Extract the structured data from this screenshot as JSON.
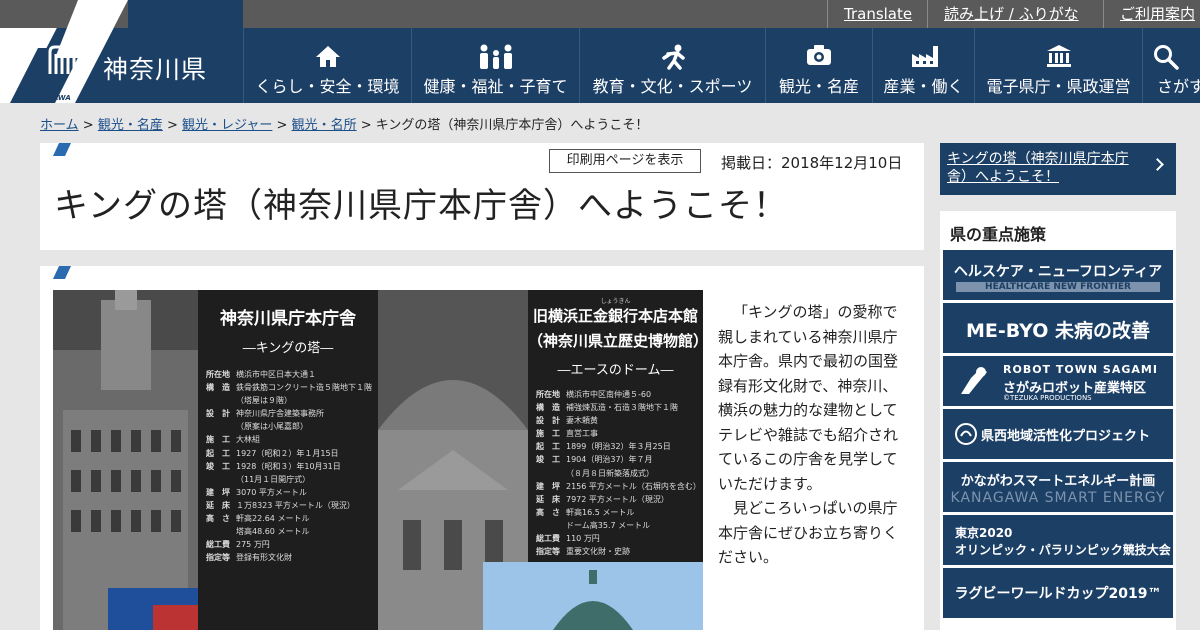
{
  "topbar": {
    "translate": "Translate",
    "read_aloud": "読み上げ / ふりがな",
    "guide": "ご利用案内"
  },
  "header": {
    "prefecture": "神奈川県",
    "logo_sub": "KANAGAWA"
  },
  "nav": [
    {
      "label": "くらし・安全・環境",
      "icon": "house-icon"
    },
    {
      "label": "健康・福祉・子育て",
      "icon": "family-icon"
    },
    {
      "label": "教育・文化・スポーツ",
      "icon": "runner-icon"
    },
    {
      "label": "観光・名産",
      "icon": "camera-icon"
    },
    {
      "label": "産業・働く",
      "icon": "factory-icon"
    },
    {
      "label": "電子県庁・県政運営",
      "icon": "government-building-icon"
    },
    {
      "label": "さがす",
      "icon": "search-icon"
    }
  ],
  "breadcrumb": {
    "home": "ホーム",
    "sep": ">",
    "crumb1": "観光・名産",
    "crumb2": "観光・レジャー",
    "crumb3": "観光・名所",
    "current": "キングの塔（神奈川県庁本庁舎）へようこそ！"
  },
  "article": {
    "print_button": "印刷用ページを表示",
    "published": "掲載日：2018年12月10日",
    "title": "キングの塔（神奈川県庁本庁舎）へようこそ！",
    "paragraph1": "「キングの塔」の愛称で親しまれている神奈川県庁本庁舎。県内で最初の国登録有形文化財で、神奈川、横浜の魅力的な建物としてテレビや雑誌でも紹介されているこの庁舎を見学していただけます。",
    "paragraph2": "見どころいっぱいの県庁本庁舎にぜひお立ち寄りください。"
  },
  "poster": {
    "left_title": "神奈川県庁本庁舎",
    "left_sub": "―キングの塔―",
    "left_specs": [
      {
        "k": "所在地",
        "v": "横浜市中区日本大通１"
      },
      {
        "k": "構　造",
        "v": "鉄骨鉄筋コンクリート造５階地下１階"
      },
      {
        "k": "",
        "v": "（塔屋は９階）"
      },
      {
        "k": "設　計",
        "v": "神奈川県庁舎建築事務所"
      },
      {
        "k": "",
        "v": "（原案は小尾嘉郎）"
      },
      {
        "k": "施　工",
        "v": "大林組"
      },
      {
        "k": "起　工",
        "v": "1927（昭和２）年１月15日"
      },
      {
        "k": "竣　工",
        "v": "1928（昭和３）年10月31日"
      },
      {
        "k": "",
        "v": "（11月１日開庁式）"
      },
      {
        "k": "建　坪",
        "v": "3070 平方メートル"
      },
      {
        "k": "延　床",
        "v": "１万8323 平方メートル（現況）"
      },
      {
        "k": "高　さ",
        "v": "軒高22.64 メートル"
      },
      {
        "k": "",
        "v": "塔高48.60 メートル"
      },
      {
        "k": "総工費",
        "v": "275 万円"
      },
      {
        "k": "指定等",
        "v": "登録有形文化財"
      }
    ],
    "right_ruby": "しょうきん",
    "right_title1": "旧横浜正金銀行本店本館",
    "right_title2": "（神奈川県立歴史博物館）",
    "right_sub": "―エースのドーム―",
    "right_specs": [
      {
        "k": "所在地",
        "v": "横浜市中区南仲通５-60"
      },
      {
        "k": "構　造",
        "v": "補強煉瓦造・石造３階地下１階"
      },
      {
        "k": "設　計",
        "v": "妻木頼黄"
      },
      {
        "k": "施　工",
        "v": "直営工事"
      },
      {
        "k": "起　工",
        "v": "1899（明治32）年３月25日"
      },
      {
        "k": "竣　工",
        "v": "1904（明治37）年７月"
      },
      {
        "k": "",
        "v": "（８月８日新築落成式）"
      },
      {
        "k": "建　坪",
        "v": "2156 平方メートル（石塀内を含む）"
      },
      {
        "k": "延　床",
        "v": "7972 平方メートル（現況）"
      },
      {
        "k": "高　さ",
        "v": "軒高16.5 メートル"
      },
      {
        "k": "",
        "v": "ドーム高35.7 メートル"
      },
      {
        "k": "総工費",
        "v": "110 万円"
      },
      {
        "k": "指定等",
        "v": "重要文化財・史跡"
      }
    ]
  },
  "sidebar": {
    "current_link": "キングの塔（神奈川県庁本庁舎）へようこそ！",
    "heading": "県の重点施策",
    "banners": [
      {
        "main": "ヘルスケア・ニューフロンティア",
        "sub": "HEALTHCARE NEW FRONTIER"
      },
      {
        "main": "ME-BYO  未病の改善",
        "sub": ""
      },
      {
        "main": "ROBOT TOWN SAGAMI",
        "sub": "さがみロボット産業特区",
        "note": "©TEZUKA PRODUCTIONS"
      },
      {
        "main": "県西地域活性化プロジェクト",
        "sub": ""
      },
      {
        "main": "かながわスマートエネルギー計画",
        "sub": "KANAGAWA SMART ENERGY"
      },
      {
        "main": "東京2020",
        "sub": "オリンピック・パラリンピック競技大会"
      },
      {
        "main": "ラグビーワールドカップ2019™",
        "sub": ""
      }
    ]
  }
}
